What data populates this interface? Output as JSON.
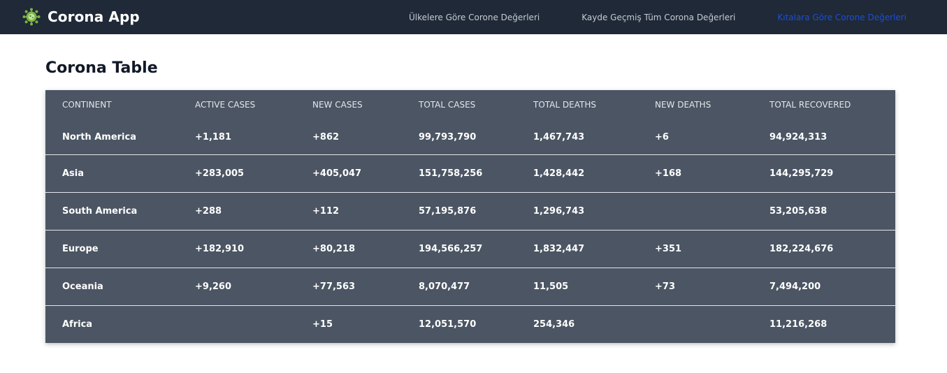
{
  "navbar": {
    "title": "Corona App",
    "icon": "virus-icon",
    "links": [
      {
        "label": "Ülkelere Göre Corone Değerleri",
        "active": false
      },
      {
        "label": "Kayde Geçmiş Tüm Corona Değerleri",
        "active": false
      },
      {
        "label": "Kıtalara Göre Corone Değerleri",
        "active": true
      }
    ]
  },
  "main": {
    "title": "Corona Table"
  },
  "table": {
    "columns": [
      "CONTINENT",
      "ACTIVE CASES",
      "NEW CASES",
      "TOTAL CASES",
      "TOTAL DEATHS",
      "NEW DEATHS",
      "TOTAL RECOVERED"
    ],
    "rows": [
      [
        "North America",
        "+1,181",
        "+862",
        "99,793,790",
        "1,467,743",
        "+6",
        "94,924,313"
      ],
      [
        "Asia",
        "+283,005",
        "+405,047",
        "151,758,256",
        "1,428,442",
        "+168",
        "144,295,729"
      ],
      [
        "South America",
        "+288",
        "+112",
        "57,195,876",
        "1,296,743",
        "",
        "53,205,638"
      ],
      [
        "Europe",
        "+182,910",
        "+80,218",
        "194,566,257",
        "1,832,447",
        "+351",
        "182,224,676"
      ],
      [
        "Oceania",
        "+9,260",
        "+77,563",
        "8,070,477",
        "11,505",
        "+73",
        "7,494,200"
      ],
      [
        "Africa",
        "",
        "+15",
        "12,051,570",
        "254,346",
        "",
        "11,216,268"
      ]
    ]
  },
  "colors": {
    "navbar_bg": "#1f2937",
    "table_bg": "#4b5563",
    "active_link": "#1d4ed8",
    "nav_link": "#c6cbd3"
  }
}
